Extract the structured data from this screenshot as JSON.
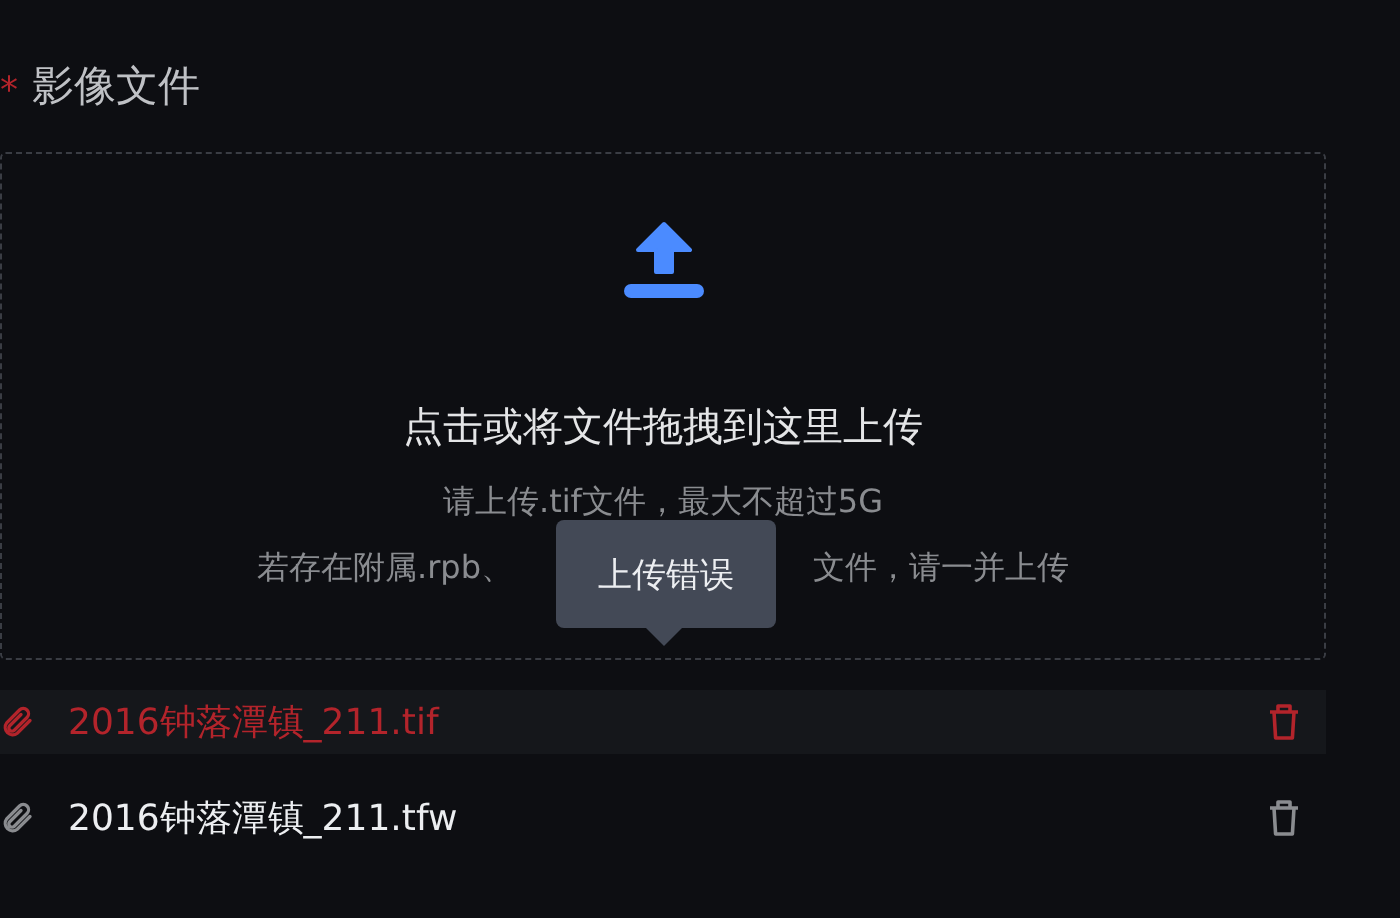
{
  "field": {
    "required_mark": "*",
    "label": "影像文件"
  },
  "upload": {
    "title": "点击或将文件拖拽到这里上传",
    "hint_line_1": "请上传.tif文件，最大不超过5G",
    "hint_line_2_start": "若存在附属.rpb、",
    "hint_line_2_end": "文件，请一并上传"
  },
  "tooltip": {
    "text": "上传错误"
  },
  "files": [
    {
      "name": "2016钟落潭镇_211.tif",
      "error": true
    },
    {
      "name": "2016钟落潭镇_211.tfw",
      "error": false
    }
  ]
}
